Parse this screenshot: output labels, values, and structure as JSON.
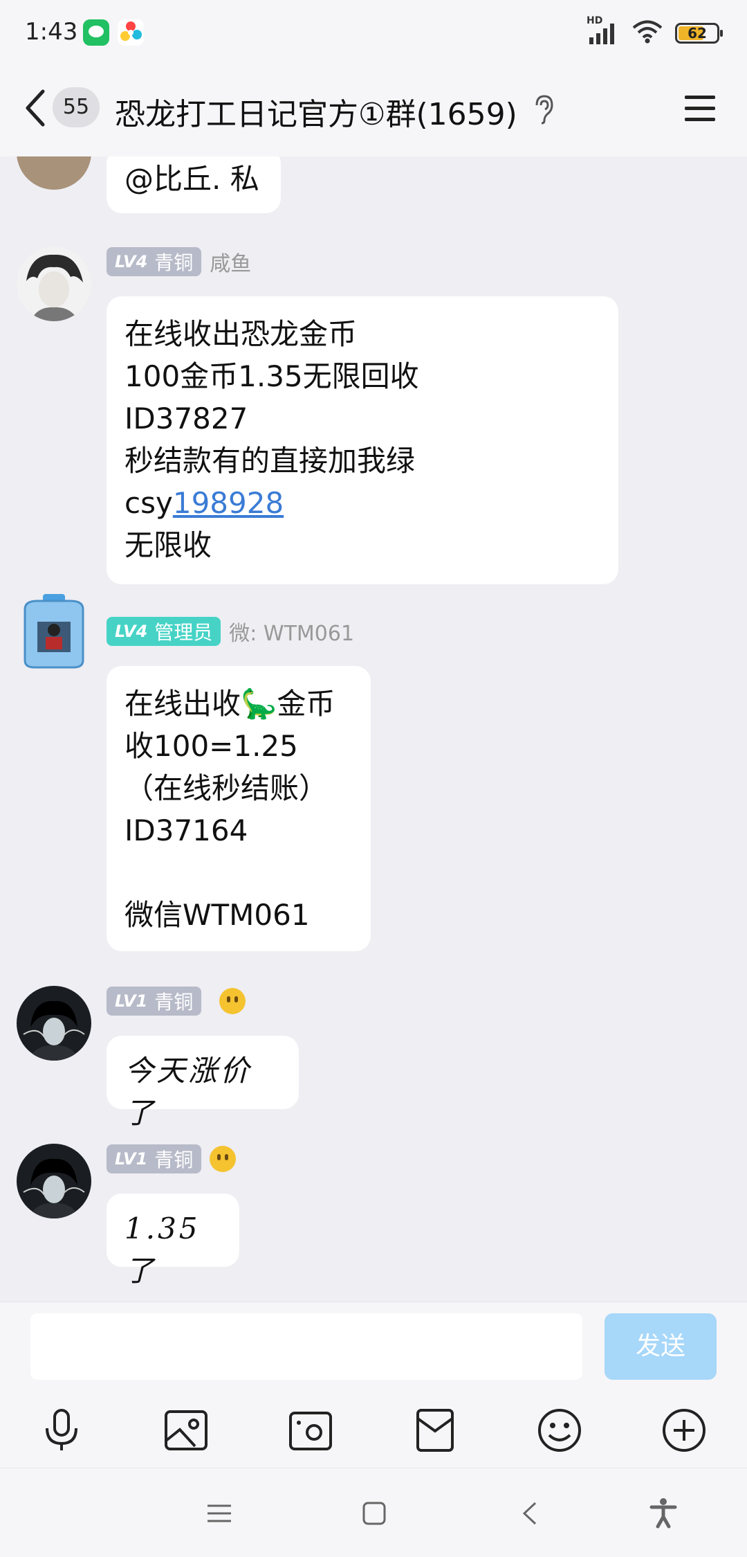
{
  "status_bar": {
    "time": "1:43",
    "network": "HD",
    "battery": "62",
    "apps": [
      "wechat-icon",
      "colorful-app-icon"
    ]
  },
  "header": {
    "back_count": "55",
    "title": "恐龙打工日记官方①群(1659)"
  },
  "messages": [
    {
      "text": "@比丘. 私"
    },
    {
      "badge_level": "LV4",
      "badge_title": "青铜",
      "nickname": "咸鱼",
      "lines_before_link": "在线收出恐龙金币\n100金币1.35无限回收\nID37827\n秒结款有的直接加我绿\ncsy",
      "link": "198928",
      "after_link": "\n无限收"
    },
    {
      "badge_level": "LV4",
      "badge_title": "管理员",
      "nickname": "微: WTM061",
      "line1_a": "在线出收",
      "line1_emoji": "🦕",
      "line1_b": "金币",
      "rest": "收100=1.25\n（在线秒结账）\nID37164\n\n微信WTM061"
    },
    {
      "badge_level": "LV1",
      "badge_title": "青铜",
      "text": "今天涨价了"
    },
    {
      "badge_level": "LV1",
      "badge_title": "青铜",
      "text": "1.35了"
    }
  ],
  "input": {
    "value": "",
    "send_label": "发送"
  },
  "toolbar": [
    "microphone-icon",
    "image-icon",
    "camera-icon",
    "red-packet-icon",
    "emoji-icon",
    "plus-icon"
  ],
  "colors": {
    "chat_bg": "#eeeef3",
    "link": "#3a7bd5",
    "send_disabled": "#a7d7f9",
    "badge_gray": "#b7bac8",
    "badge_admin": "#46d3c6"
  }
}
